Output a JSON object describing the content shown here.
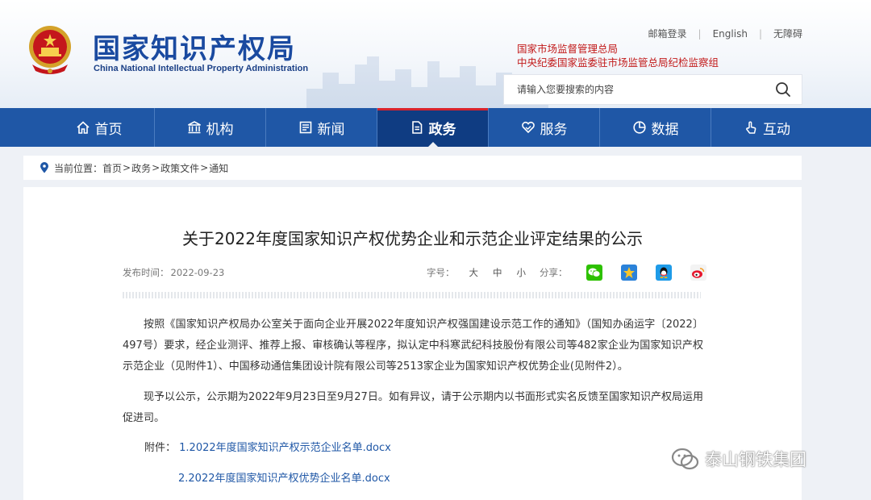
{
  "header": {
    "logo_cn": "国家知识产权局",
    "logo_en": "China National Intellectual Property Administration",
    "links": [
      "邮箱登录",
      "English",
      "无障碍"
    ],
    "agency_lines": [
      "国家市场监督管理总局",
      "中央纪委国家监委驻市场监管总局纪检监察组"
    ],
    "search_placeholder": "请输入您要搜索的内容"
  },
  "nav": {
    "items": [
      {
        "label": "首页",
        "icon": "home-icon"
      },
      {
        "label": "机构",
        "icon": "building-icon"
      },
      {
        "label": "新闻",
        "icon": "newspaper-icon"
      },
      {
        "label": "政务",
        "icon": "document-icon",
        "active": true
      },
      {
        "label": "服务",
        "icon": "heart-hand-icon"
      },
      {
        "label": "数据",
        "icon": "pie-chart-icon"
      },
      {
        "label": "互动",
        "icon": "touch-icon"
      }
    ]
  },
  "breadcrumb": {
    "prefix": "当前位置：",
    "items": [
      "首页",
      "政务",
      "政策文件",
      "通知"
    ]
  },
  "article": {
    "title": "关于2022年度国家知识产权优势企业和示范企业评定结果的公示",
    "date_label": "发布时间：",
    "date": "2022-09-23",
    "fontsize_label": "字号：",
    "fontsizes": [
      "大",
      "中",
      "小"
    ],
    "share_label": "分享：",
    "share_icons": [
      "wechat-icon",
      "qzone-icon",
      "qq-icon",
      "weibo-icon"
    ],
    "paragraphs": [
      "按照《国家知识产权局办公室关于面向企业开展2022年度知识产权强国建设示范工作的通知》（国知办函运字〔2022〕497号）要求，经企业测评、推荐上报、审核确认等程序，拟认定中科寒武纪科技股份有限公司等482家企业为国家知识产权示范企业（见附件1）、中国移动通信集团设计院有限公司等2513家企业为国家知识产权优势企业(见附件2）。",
      "现予以公示，公示期为2022年9月23日至9月27日。如有异议，请于公示期内以书面形式实名反馈至国家知识产权局运用促进司。"
    ],
    "attach_label": "附件：",
    "attachments": [
      "1.2022年度国家知识产权示范企业名单.docx",
      "2.2022年度国家知识产权优势企业名单.docx"
    ]
  },
  "watermark": "泰山钢铁集团",
  "colors": {
    "nav": "#1f57a6",
    "nav_active": "#0f3c82",
    "accent_red": "#c21a1a",
    "link": "#1f57a6"
  }
}
